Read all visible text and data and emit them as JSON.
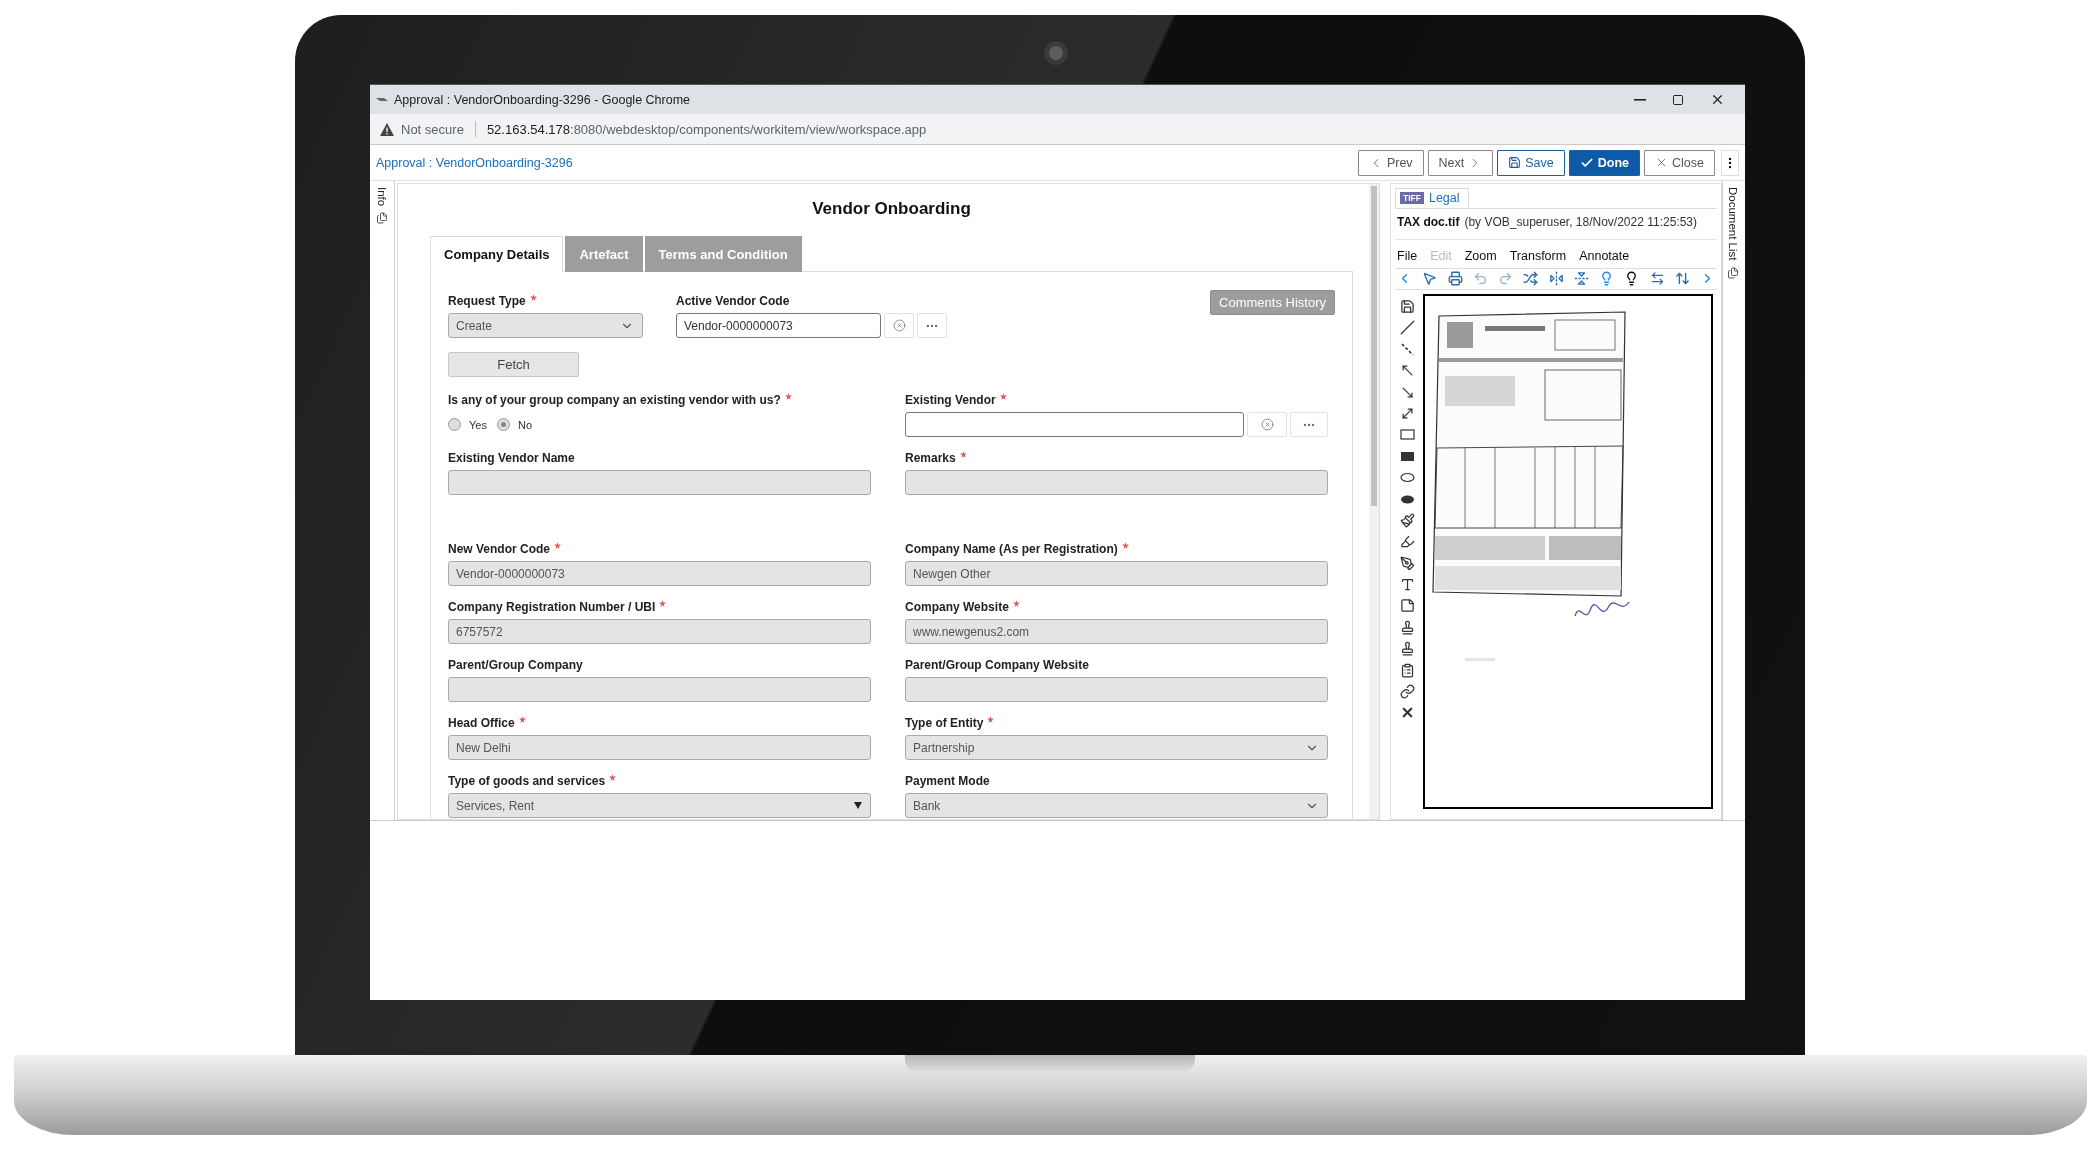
{
  "browser": {
    "title": "Approval : VendorOnboarding-3296 - Google Chrome",
    "security": "Not secure",
    "url_host": "52.163.54.178",
    "url_path": ":8080/webdesktop/components/workitem/view/workspace.app"
  },
  "header": {
    "breadcrumb": "Approval : VendorOnboarding-3296",
    "buttons": [
      {
        "label": "Prev",
        "kind": "prev"
      },
      {
        "label": "Next",
        "kind": "next"
      },
      {
        "label": "Save",
        "kind": "save"
      },
      {
        "label": "Done",
        "kind": "done"
      },
      {
        "label": "Close",
        "kind": "close"
      }
    ]
  },
  "side_tabs": {
    "left": "Info",
    "right": "Document List"
  },
  "form": {
    "title": "Vendor Onboarding",
    "tabs": [
      {
        "label": "Company Details",
        "selected": true
      },
      {
        "label": "Artefact",
        "selected": false
      },
      {
        "label": "Terms and Condition",
        "selected": false
      }
    ],
    "comments_button": "Comments History",
    "fetch_button": "Fetch",
    "top_fields": [
      {
        "label": "Request Type",
        "required": true,
        "kind": "select",
        "value": "Create",
        "disabled": true
      },
      {
        "label": "Active Vendor Code",
        "required": false,
        "kind": "lookup",
        "value": "Vendor-0000000073",
        "disabled": false
      }
    ],
    "sections": [
      [
        [
          {
            "label": "Is any of your group company an existing vendor with us?",
            "required": true,
            "kind": "radio",
            "disabled": true,
            "options": [
              {
                "label": "Yes",
                "selected": false
              },
              {
                "label": "No",
                "selected": true
              }
            ]
          },
          {
            "label": "Existing Vendor",
            "required": true,
            "kind": "lookup",
            "disabled": false
          }
        ],
        [
          {
            "label": "Existing Vendor Name",
            "required": false,
            "kind": "text",
            "disabled": true
          },
          {
            "label": "Remarks",
            "required": true,
            "kind": "text",
            "disabled": true
          }
        ]
      ],
      [
        [
          {
            "label": "New Vendor Code",
            "required": true,
            "kind": "text",
            "value": "Vendor-0000000073",
            "disabled": true
          },
          {
            "label": "Company Name (As per Registration)",
            "required": true,
            "kind": "text",
            "value": "Newgen Other",
            "disabled": true
          }
        ],
        [
          {
            "label": "Company Registration Number / UBI",
            "required": true,
            "kind": "text",
            "value": "6757572",
            "disabled": true
          },
          {
            "label": "Company Website",
            "required": true,
            "kind": "text",
            "value": "www.newgenus2.com",
            "disabled": true
          }
        ],
        [
          {
            "label": "Parent/Group Company",
            "required": false,
            "kind": "text",
            "disabled": true
          },
          {
            "label": "Parent/Group Company Website",
            "required": false,
            "kind": "text",
            "disabled": true
          }
        ],
        [
          {
            "label": "Head Office",
            "required": true,
            "kind": "text",
            "value": "New Delhi",
            "disabled": true
          },
          {
            "label": "Type of Entity",
            "required": true,
            "kind": "select",
            "value": "Partnership",
            "disabled": true
          }
        ],
        [
          {
            "label": "Type of goods and services",
            "required": true,
            "kind": "dropdown",
            "value": "Services, Rent",
            "disabled": true
          },
          {
            "label": "Payment Mode",
            "required": false,
            "kind": "select",
            "value": "Bank",
            "disabled": true
          }
        ]
      ]
    ]
  },
  "document": {
    "tabs": [
      {
        "badge": "TIFF",
        "label": "Legal",
        "selected": true
      }
    ],
    "file_name": "TAX doc.tif",
    "file_meta": "(by VOB_superuser, 18/Nov/2022 11:25:53)",
    "menu": [
      {
        "label": "File",
        "disabled": false
      },
      {
        "label": "Edit",
        "disabled": true
      },
      {
        "label": "Zoom",
        "disabled": false
      },
      {
        "label": "Transform",
        "disabled": false
      },
      {
        "label": "Annotate",
        "disabled": false
      }
    ]
  }
}
